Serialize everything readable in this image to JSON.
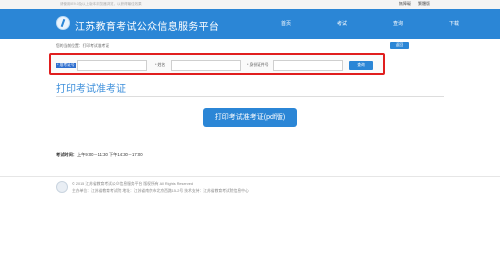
{
  "topbar": {
    "notice": "请使用IE9.0及以上版本浏览器浏览，以获得最佳效果",
    "links": [
      "無障礙",
      "繁體版"
    ]
  },
  "header": {
    "site_title": "江苏教育考试公众信息服务平台",
    "nav": [
      {
        "label": "首页"
      },
      {
        "label": "考试"
      },
      {
        "label": "查询"
      },
      {
        "label": "下载"
      }
    ]
  },
  "breadcrumb": "您的当前位置：打印考试准考证",
  "back_button": "返回",
  "search_form": {
    "fields": [
      {
        "label": "* 准考证号",
        "value": ""
      },
      {
        "label": "* 姓名",
        "value": ""
      },
      {
        "label": "* 身份证件号",
        "value": ""
      }
    ],
    "query_button": "查询"
  },
  "section_title": "打印考试准考证",
  "print_button": "打印考试准考证(pdf版)",
  "exam_time": {
    "label": "考试时间：",
    "value": "上午9:00－11:30  下午14:30－17:00"
  },
  "footer": {
    "line1": "© 2015 江苏省教育考试公众信息服务平台 版权所有 All Rights Reserved",
    "line2": "主办单位：江苏省教育考试院  地址：江苏省南京市北京西路15-2号  技术支持：江苏省教育考试院信息中心"
  }
}
